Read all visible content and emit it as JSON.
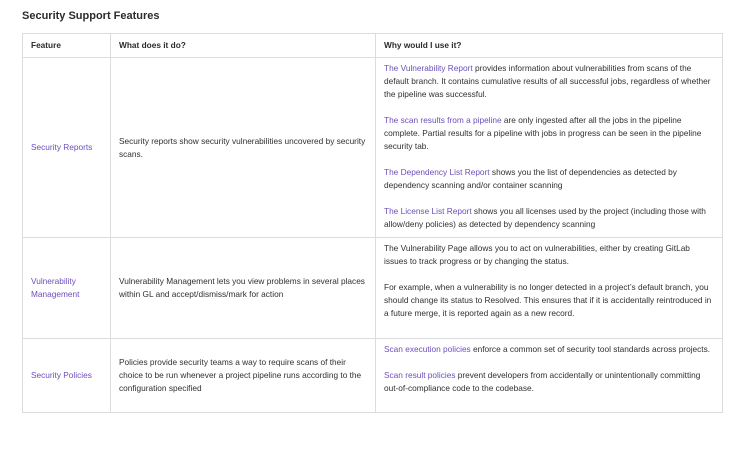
{
  "heading": "Security Support Features",
  "columns": [
    "Feature",
    "What does it do?",
    "Why would I use it?"
  ],
  "colors": {
    "link": "#6b4fbb",
    "border": "#dcdcde",
    "text": "#303030"
  },
  "rows": [
    {
      "feature": "Security Reports",
      "what": "Security reports show security vulnerabilities uncovered by security scans.",
      "why": [
        {
          "link": "The Vulnerability Report",
          "text": " provides information about vulnerabilities from scans of the default branch. It contains cumulative results of all successful jobs, regardless of whether the pipeline was successful."
        },
        {
          "link": "The scan results from a pipeline",
          "text": " are only ingested after all the jobs in the pipeline complete. Partial results for a pipeline with jobs in progress can be seen in the pipeline security tab."
        },
        {
          "link": "The Dependency List Report",
          "text": " shows you the list of dependencies as detected by dependency scanning and/or container scanning"
        },
        {
          "link": "The License List Report",
          "text": " shows you all licenses used by the project (including those with allow/deny policies) as detected by dependency scanning"
        }
      ]
    },
    {
      "feature": "Vulnerability Management",
      "what": "Vulnerability Management lets you view problems in several places within GL and accept/dismiss/mark for action",
      "why": [
        {
          "link": "",
          "text": "The Vulnerability Page allows you to act on vulnerabilities, either by creating GitLab issues to track progress or by changing the status."
        },
        {
          "link": "",
          "text": "For example, when a vulnerability is no longer detected in a project’s default branch, you should change its status to Resolved. This ensures that if it is accidentally reintroduced in a future merge, it is reported again as a new record."
        }
      ]
    },
    {
      "feature": "Security Policies",
      "what": "Policies provide security teams a way to require scans of their choice to be run whenever a project pipeline runs according to the configuration specified",
      "why": [
        {
          "link": "Scan execution policies",
          "text": " enforce a common set of security tool standards across projects."
        },
        {
          "link": "Scan result policies",
          "text": " prevent developers from accidentally or unintentionally committing out-of-compliance code to the codebase."
        }
      ]
    }
  ]
}
